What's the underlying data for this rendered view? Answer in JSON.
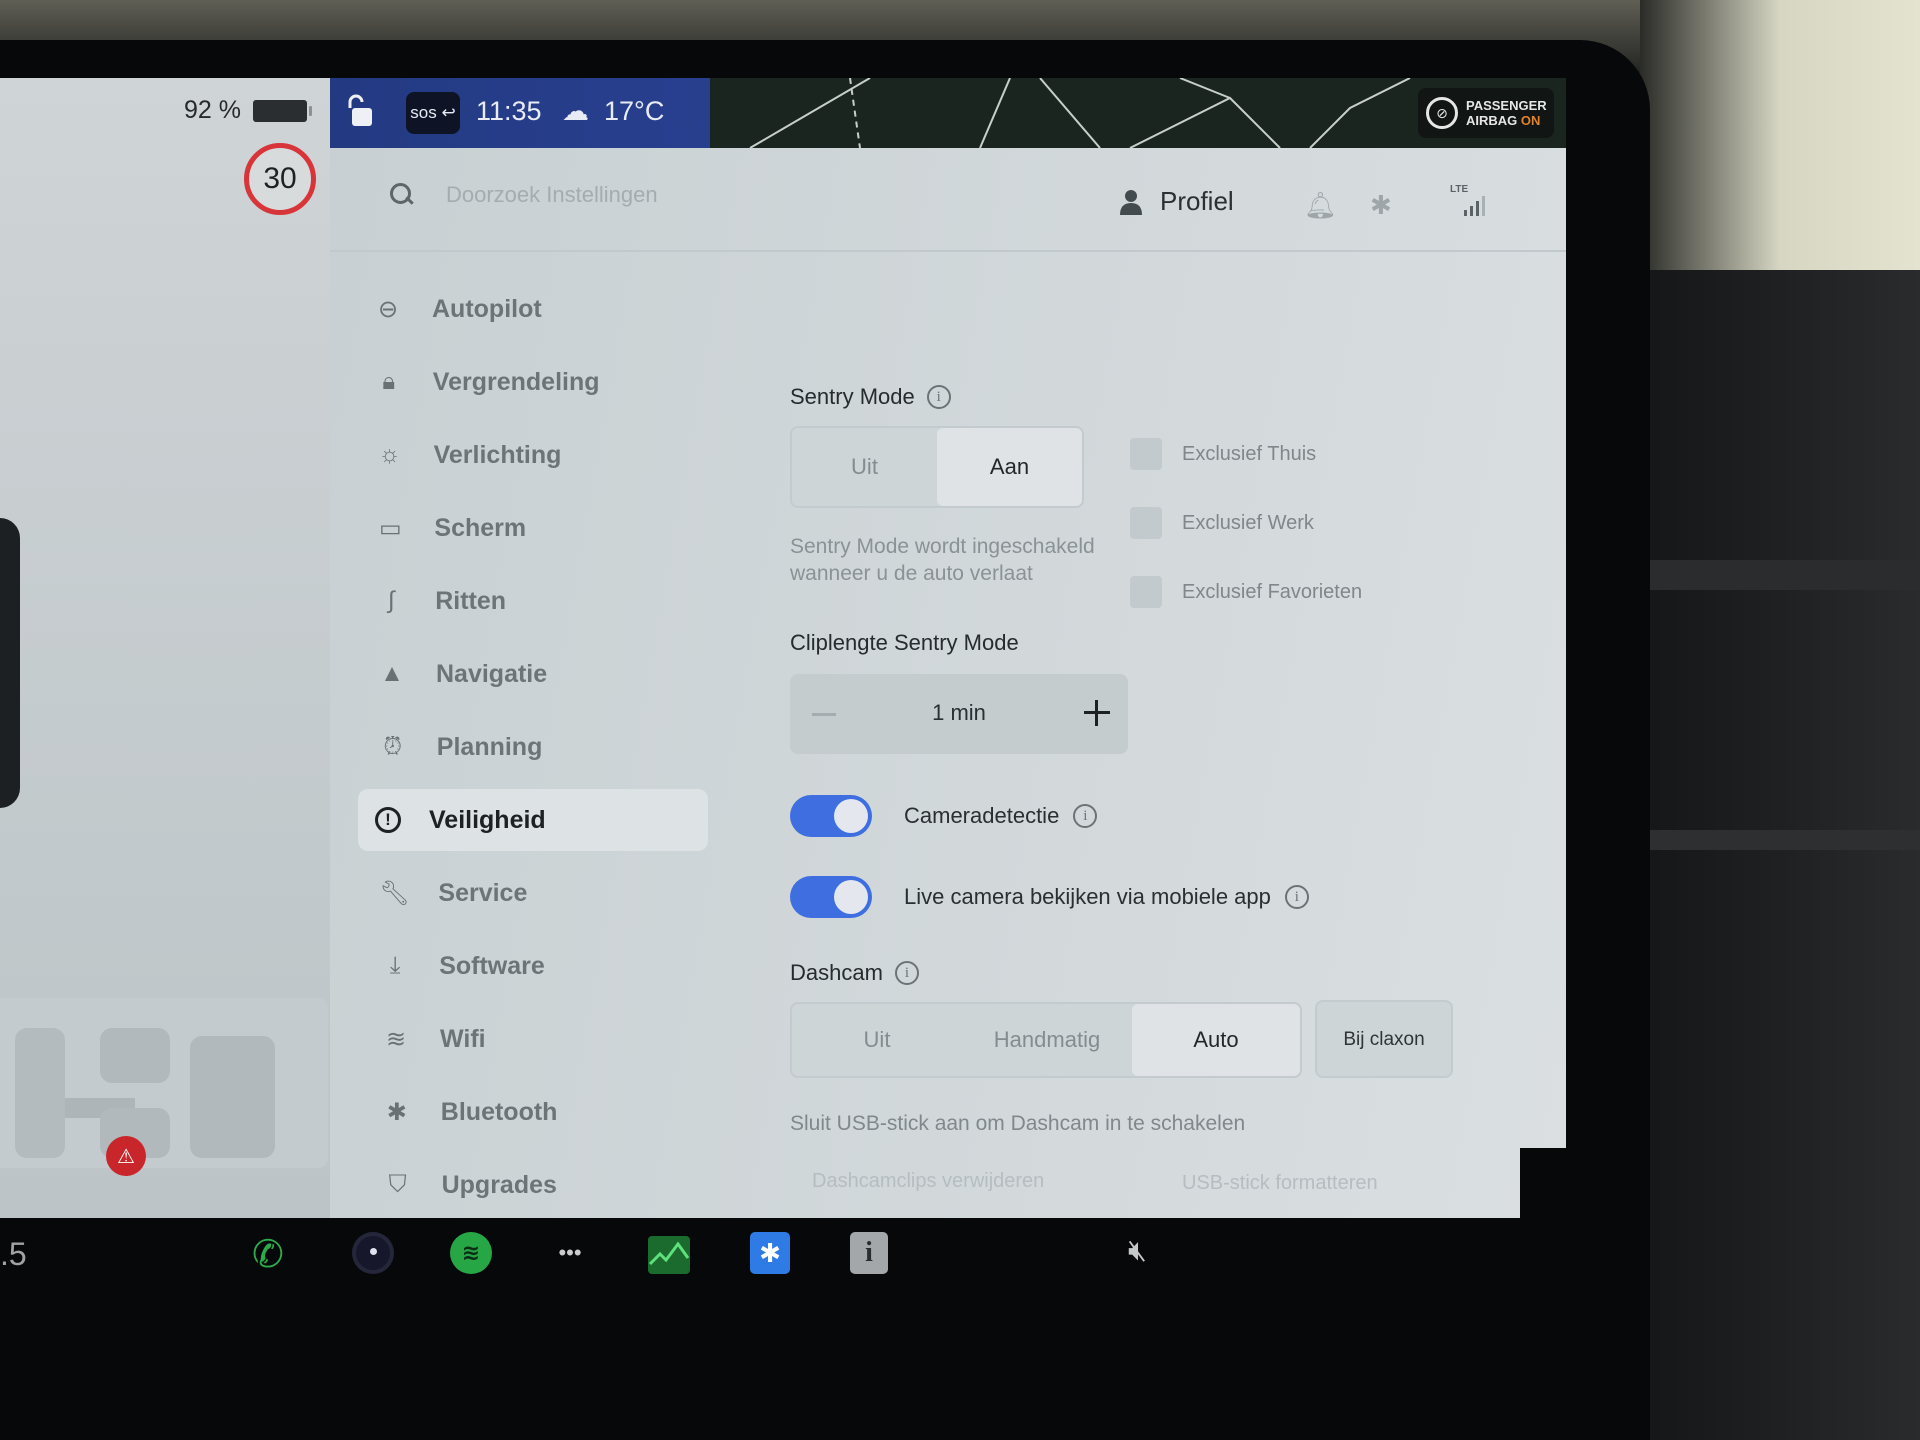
{
  "status": {
    "battery_percent": "92 %",
    "speed_limit": "30",
    "sos_label": "sos",
    "time": "11:35",
    "temperature": "17°C",
    "airbag_line1": "PASSENGER",
    "airbag_line2": "AIRBAG",
    "airbag_state": "ON"
  },
  "header": {
    "search_placeholder": "Doorzoek Instellingen",
    "profile_label": "Profiel",
    "network_label": "LTE"
  },
  "sidebar": {
    "items": [
      {
        "label": "Autopilot",
        "icon": "steering-wheel-icon"
      },
      {
        "label": "Vergrendeling",
        "icon": "lock-icon"
      },
      {
        "label": "Verlichting",
        "icon": "light-icon"
      },
      {
        "label": "Scherm",
        "icon": "display-icon"
      },
      {
        "label": "Ritten",
        "icon": "trips-icon"
      },
      {
        "label": "Navigatie",
        "icon": "navigation-icon"
      },
      {
        "label": "Planning",
        "icon": "alarm-clock-icon"
      },
      {
        "label": "Veiligheid",
        "icon": "alert-circle-icon",
        "active": true
      },
      {
        "label": "Service",
        "icon": "wrench-icon"
      },
      {
        "label": "Software",
        "icon": "download-icon"
      },
      {
        "label": "Wifi",
        "icon": "wifi-icon"
      },
      {
        "label": "Bluetooth",
        "icon": "bluetooth-icon"
      },
      {
        "label": "Upgrades",
        "icon": "shopping-bag-icon"
      }
    ]
  },
  "sentry": {
    "title": "Sentry Mode",
    "options": [
      "Uit",
      "Aan"
    ],
    "selected": "Aan",
    "description": "Sentry Mode wordt ingeschakeld wanneer u de auto verlaat",
    "exclusions": [
      {
        "label": "Exclusief Thuis",
        "checked": false
      },
      {
        "label": "Exclusief Werk",
        "checked": false
      },
      {
        "label": "Exclusief Favorieten",
        "checked": false
      }
    ],
    "clip_title": "Cliplengte Sentry Mode",
    "clip_value": "1 min",
    "camera_detection_label": "Cameradetectie",
    "camera_detection_on": true,
    "live_camera_label": "Live camera bekijken via mobiele app",
    "live_camera_on": true
  },
  "dashcam": {
    "title": "Dashcam",
    "options": [
      "Uit",
      "Handmatig",
      "Auto"
    ],
    "selected": "Auto",
    "horn_option": "Bij claxon",
    "usb_notice": "Sluit USB-stick aan om Dashcam in te schakelen",
    "delete_clips": "Dashcamclips verwijderen",
    "format_usb": "USB-stick formatteren"
  },
  "dock": {
    "left_text": ".5",
    "apps": [
      "phone-icon",
      "camera-icon",
      "spotify-icon",
      "more-icon",
      "stocks-icon",
      "bluetooth-icon",
      "info-icon"
    ],
    "volume": "mute-icon"
  },
  "colors": {
    "accent": "#3e6ee0",
    "speed_ring": "#d8353a",
    "airbag_on": "#e1822e",
    "statusbar_blue": "#283f8f"
  }
}
